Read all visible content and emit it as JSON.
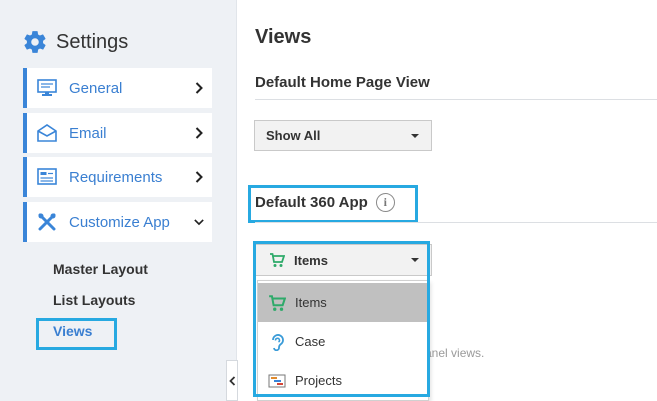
{
  "sidebar": {
    "title": "Settings",
    "items": [
      {
        "label": "General"
      },
      {
        "label": "Email"
      },
      {
        "label": "Requirements"
      },
      {
        "label": "Customize App"
      }
    ],
    "sub_items": [
      {
        "label": "Master Layout"
      },
      {
        "label": "List Layouts"
      },
      {
        "label": "Views"
      }
    ],
    "accent": "#3a85d8",
    "highlight": "#27a9e1"
  },
  "main": {
    "title": "Views",
    "home_view": {
      "heading": "Default Home Page View",
      "selected": "Show All"
    },
    "app_360": {
      "heading": "Default 360 App",
      "info_icon": "i",
      "selected": "Items",
      "options": [
        {
          "label": "Items",
          "icon": "cart-icon"
        },
        {
          "label": "Case",
          "icon": "ear-icon"
        },
        {
          "label": "Projects",
          "icon": "gantt-icon"
        }
      ]
    },
    "background_text": "anel views."
  }
}
